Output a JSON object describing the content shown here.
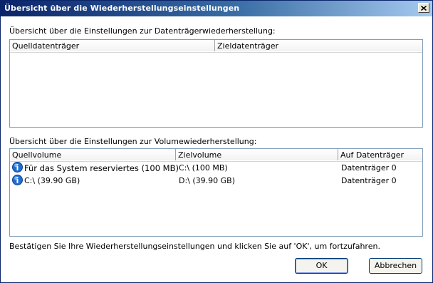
{
  "window": {
    "title": "Übersicht über die Wiederherstellungseinstellungen"
  },
  "disk_section": {
    "label": "Übersicht über die Einstellungen zur Datenträgerwiederherstellung:",
    "columns": [
      "Quelldatenträger",
      "Zieldatenträger"
    ],
    "rows": []
  },
  "volume_section": {
    "label": "Übersicht über die Einstellungen zur Volumewiederherstellung:",
    "columns": [
      "Quellvolume",
      "Zielvolume",
      "Auf Datenträger"
    ],
    "rows": [
      {
        "icon": "disk-info-icon",
        "source": "Für das System reserviertes (100 MB)",
        "target": "C:\\ (100 MB)",
        "disk": "Datenträger 0"
      },
      {
        "icon": "disk-info-icon",
        "source": "C:\\ (39.90 GB)",
        "target": "D:\\ (39.90 GB)",
        "disk": "Datenträger 0"
      }
    ]
  },
  "footer": {
    "instruction": "Bestätigen Sie Ihre Wiederherstellungseinstellungen und klicken Sie auf 'OK', um fortzufahren.",
    "ok_label": "OK",
    "cancel_label": "Abbrechen"
  },
  "colors": {
    "titlebar_start": "#0a246a",
    "titlebar_end": "#a6caf0",
    "list_border": "#7f9db9",
    "icon_blue": "#1f6fd1"
  }
}
